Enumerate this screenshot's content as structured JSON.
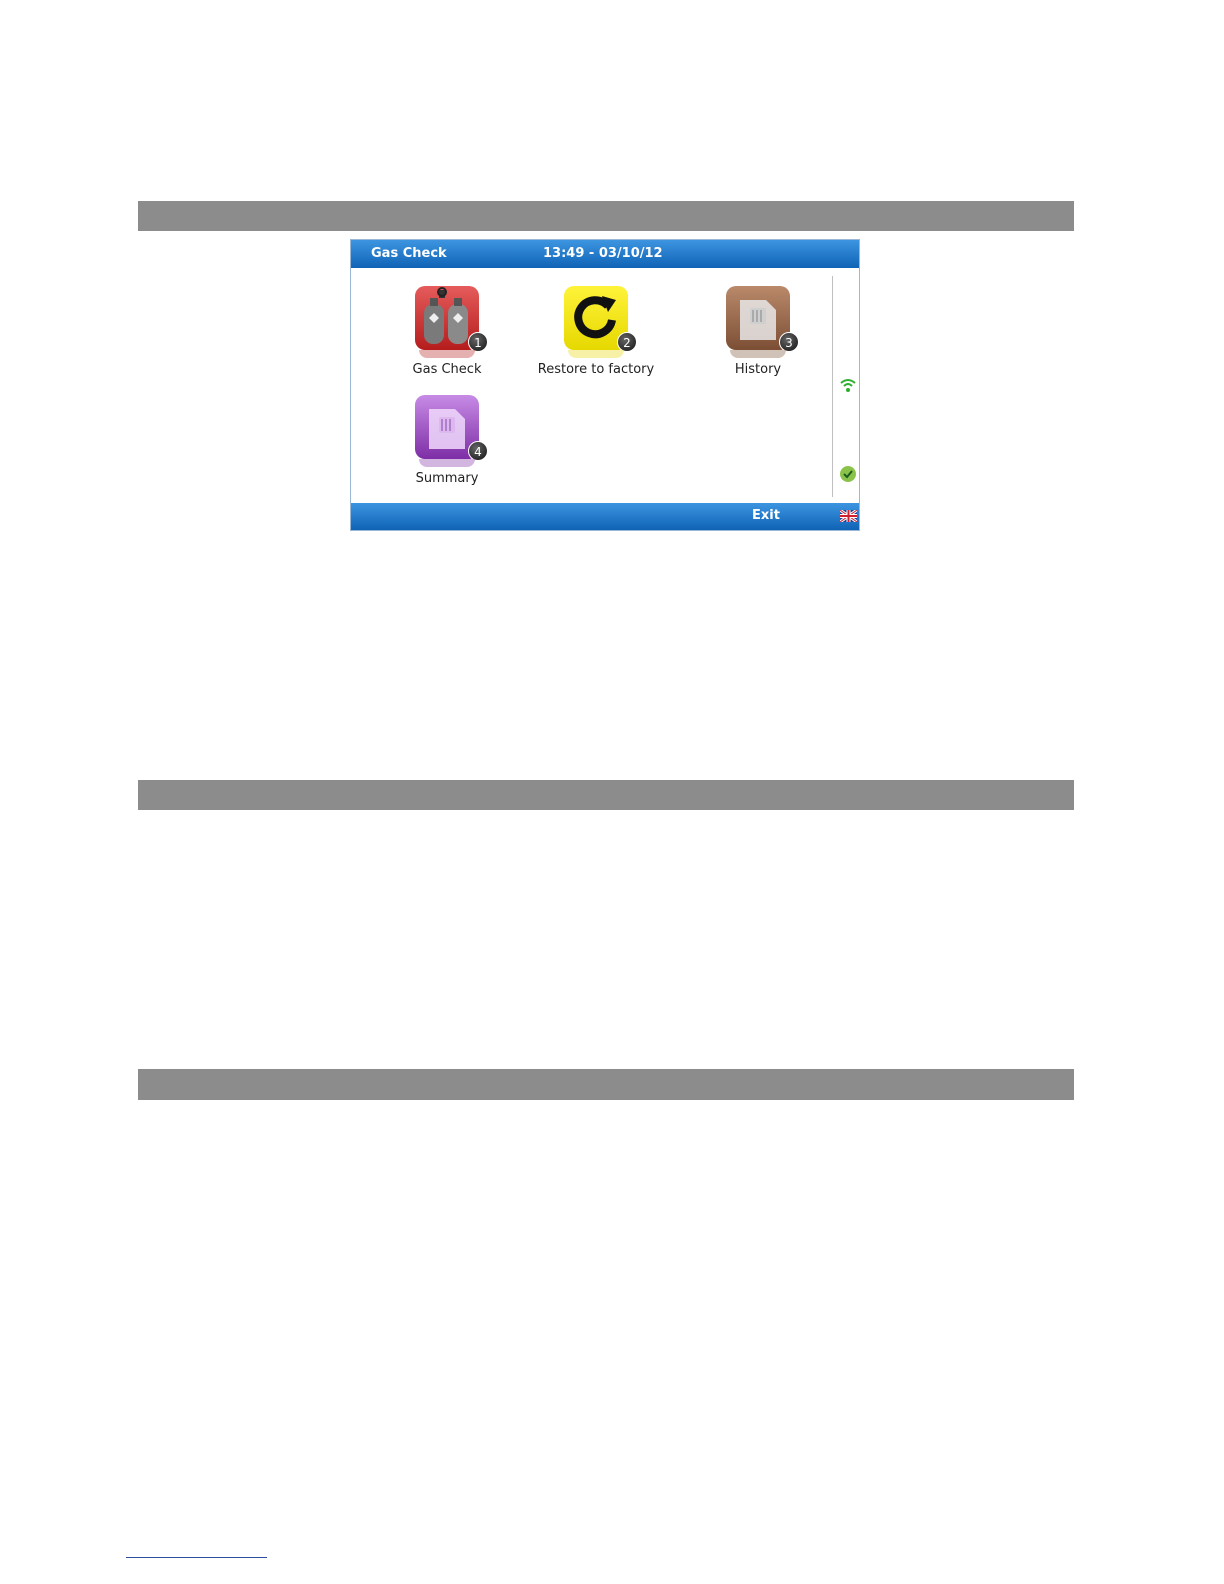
{
  "screen": {
    "title": "Gas Check",
    "datetime": "13:49 - 03/10/12",
    "exit_label": "Exit",
    "menu": [
      {
        "label": "Gas Check",
        "number": "1",
        "icon": "gas-cylinders-icon",
        "color": "#c62828"
      },
      {
        "label": "Restore to factory",
        "number": "2",
        "icon": "restore-icon",
        "color": "#f2e400"
      },
      {
        "label": "History",
        "number": "3",
        "icon": "history-folder-icon",
        "color": "#8d5b3c"
      },
      {
        "label": "Summary",
        "number": "4",
        "icon": "summary-folder-icon",
        "color": "#9340bd"
      }
    ],
    "status_icons": [
      "wifi-signal-icon",
      "ok-check-icon"
    ],
    "language_icon": "uk-flag-icon"
  },
  "colors": {
    "bar_blue": "#1672c8",
    "section_gray": "#8c8c8c"
  }
}
